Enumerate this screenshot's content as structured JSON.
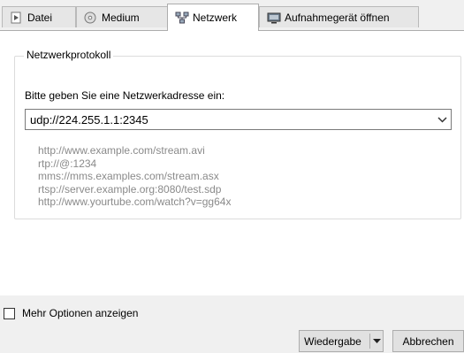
{
  "tabs": [
    {
      "label": "Datei",
      "icon": "file-icon",
      "active": false
    },
    {
      "label": "Medium",
      "icon": "disc-icon",
      "active": false
    },
    {
      "label": "Netzwerk",
      "icon": "network-icon",
      "active": true
    },
    {
      "label": "Aufnahmegerät öffnen",
      "icon": "capture-device-icon",
      "active": false
    }
  ],
  "group": {
    "title": "Netzwerkprotokoll",
    "prompt": "Bitte geben Sie eine Netzwerkadresse ein:",
    "url_value": "udp://224.255.1.1:2345",
    "examples": [
      "http://www.example.com/stream.avi",
      "rtp://@:1234",
      "mms://mms.examples.com/stream.asx",
      "rtsp://server.example.org:8080/test.sdp",
      "http://www.yourtube.com/watch?v=gg64x"
    ]
  },
  "footer": {
    "more_options_label": "Mehr Optionen anzeigen",
    "play_label": "Wiedergabe",
    "cancel_label": "Abbrechen"
  },
  "colors": {
    "tab_active_bg": "#ffffff",
    "tab_inactive_bg": "#e6e6e6",
    "example_text": "#8a8a8a",
    "button_bg": "#e1e1e1"
  }
}
